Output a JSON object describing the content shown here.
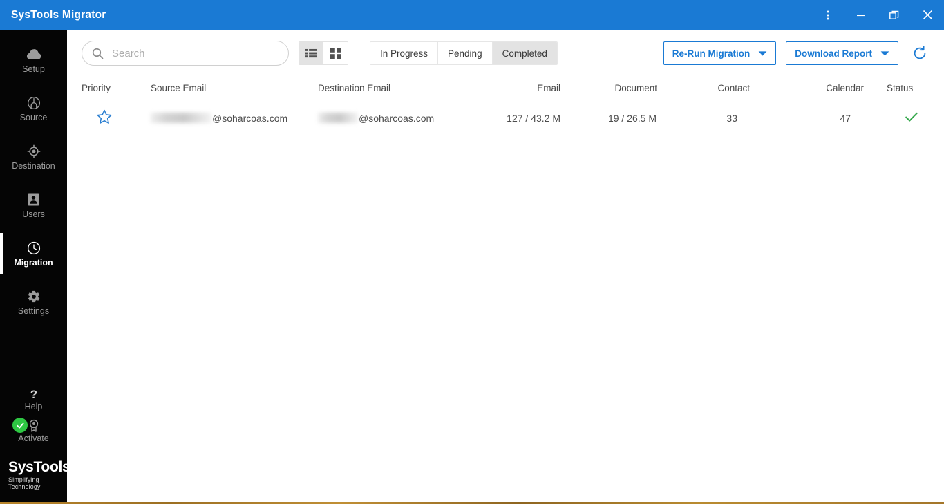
{
  "titlebar": {
    "app_title": "SysTools Migrator",
    "controls": [
      {
        "name": "more-options-icon",
        "label": "More options"
      },
      {
        "name": "minimize-icon",
        "label": "Minimize"
      },
      {
        "name": "restore-icon",
        "label": "Restore"
      },
      {
        "name": "close-icon",
        "label": "Close"
      }
    ],
    "background_color": "#1a7ad4"
  },
  "sidebar": {
    "background_color": "#050505",
    "active_item": "Migration",
    "items": [
      {
        "label": "Setup",
        "icon": "cloud-icon"
      },
      {
        "label": "Source",
        "icon": "source-node-icon"
      },
      {
        "label": "Destination",
        "icon": "target-icon"
      },
      {
        "label": "Users",
        "icon": "user-card-icon"
      },
      {
        "label": "Migration",
        "icon": "clock-icon"
      },
      {
        "label": "Settings",
        "icon": "gear-icon"
      }
    ],
    "bottom_items": [
      {
        "label": "Help",
        "icon": "question-mark-icon"
      },
      {
        "label": "Activate",
        "icon": "activation-badge-icon",
        "badge": "green-check"
      }
    ],
    "logo": {
      "name": "SysTools",
      "registered_mark": "®",
      "tagline": "Simplifying Technology"
    }
  },
  "toolbar": {
    "search": {
      "placeholder": "Search",
      "value": "",
      "icon": "search-icon"
    },
    "view_modes": [
      {
        "name": "list-view",
        "icon": "list-view-icon",
        "active": true
      },
      {
        "name": "grid-view",
        "icon": "grid-view-icon",
        "active": false
      }
    ],
    "status_tabs": [
      {
        "label": "In Progress",
        "active": false
      },
      {
        "label": "Pending",
        "active": false
      },
      {
        "label": "Completed",
        "active": true
      }
    ],
    "actions": [
      {
        "label": "Re-Run Migration",
        "icon": "chevron-down-icon"
      },
      {
        "label": "Download Report",
        "icon": "chevron-down-icon"
      }
    ],
    "refresh": {
      "icon": "refresh-icon"
    },
    "accent_color": "#1a7ad4"
  },
  "table": {
    "columns": [
      "Priority",
      "Source Email",
      "Destination Email",
      "Email",
      "Document",
      "Contact",
      "Calendar",
      "Status"
    ],
    "rows": [
      {
        "priority_icon": "star-outline-icon",
        "source_email_suffix": "@soharcoas.com",
        "destination_email_suffix": "@soharcoas.com",
        "email": "127 / 43.2 M",
        "document": "19 / 26.5 M",
        "contact": "33",
        "calendar": "47",
        "status_icon": "check-icon",
        "status_color": "#35a84c"
      }
    ]
  }
}
